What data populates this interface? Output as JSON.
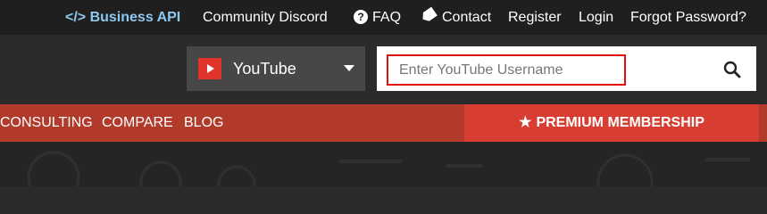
{
  "topbar": {
    "business_api": "</> Business API",
    "community_discord": "Community Discord",
    "faq": "FAQ",
    "contact": "Contact",
    "register": "Register",
    "login": "Login",
    "forgot_password": "Forgot Password?"
  },
  "search": {
    "platform": "YouTube",
    "placeholder": "Enter YouTube Username",
    "value": ""
  },
  "nav": {
    "items": [
      "CONSULTING",
      "COMPARE",
      "BLOG"
    ],
    "premium": "PREMIUM MEMBERSHIP"
  },
  "icons": {
    "faq": "question-circle-icon",
    "contact": "tag-icon",
    "platform": "youtube-play-icon",
    "dropdown": "caret-down-icon",
    "search": "search-icon",
    "premium": "star-icon"
  },
  "colors": {
    "topbar_bg": "#1f1f1f",
    "api_link": "#8ec8f0",
    "nav_bg": "#b23a2b",
    "premium_bg": "#d73d30",
    "input_border": "#e01010"
  }
}
